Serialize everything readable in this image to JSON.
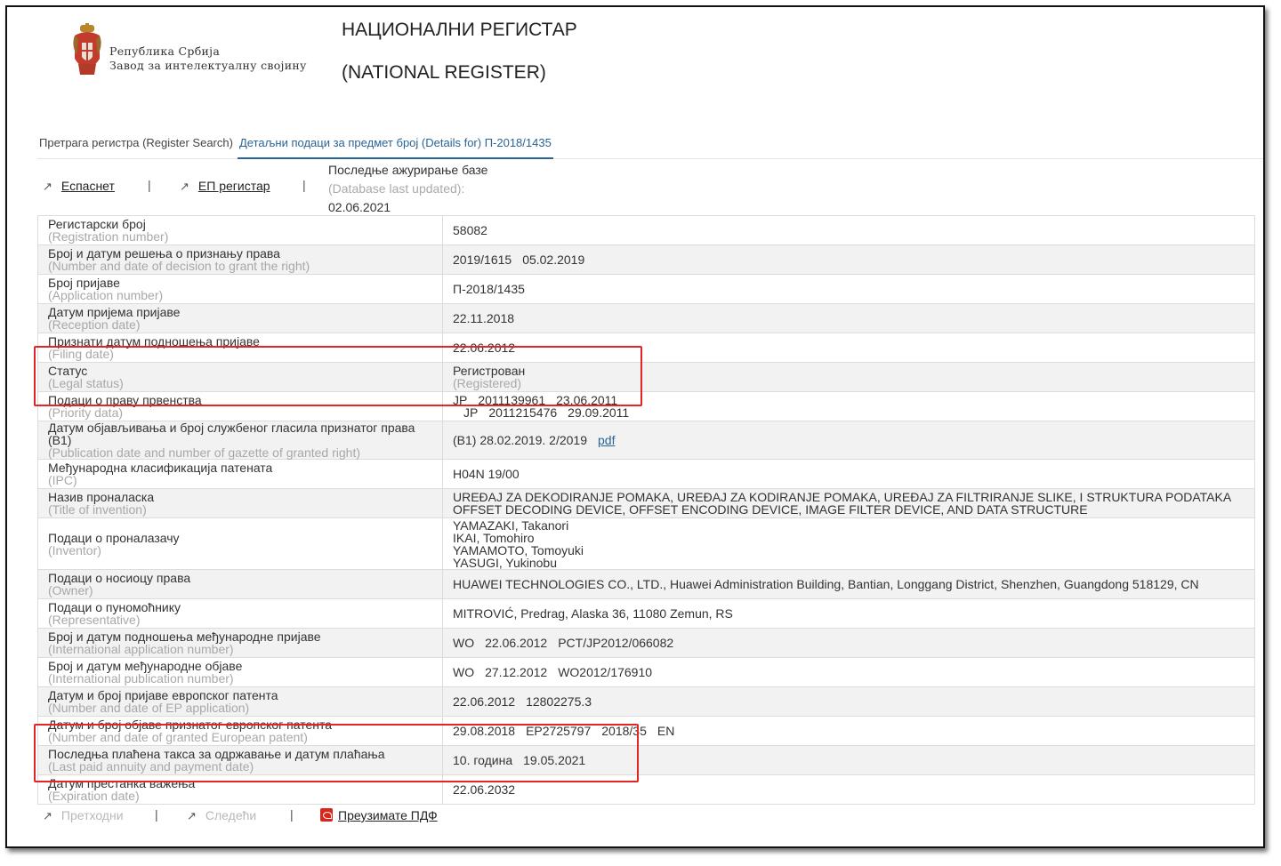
{
  "header": {
    "institution_line1": "Република Србија",
    "institution_line2": "Завод за интелектуалну својину",
    "title_sr": "НАЦИОНАЛНИ РЕГИСТАР",
    "title_en": "(NATIONAL REGISTER)"
  },
  "tabs": {
    "search": "Претрага регистра (Register Search)",
    "details": "Детаљни подаци за предмет број (Details for) П-2018/1435"
  },
  "links": {
    "espacenet": "Еспаснет",
    "ep_register": "ЕП регистар",
    "separator": "|"
  },
  "db_update": {
    "label_sr": "Последње ажурирање базе",
    "label_en": "(Database last updated):",
    "date": "02.06.2021"
  },
  "rows": [
    {
      "label_sr": "Регистарски број",
      "label_en": "(Registration number)",
      "value": "58082"
    },
    {
      "label_sr": "Број и датум решења о признању права",
      "label_en": "(Number and date of decision to grant the right)",
      "value_a": "2019/1615",
      "value_b": "05.02.2019"
    },
    {
      "label_sr": "Број пријаве",
      "label_en": "(Application number)",
      "value": "П-2018/1435"
    },
    {
      "label_sr": "Датум пријема пријаве",
      "label_en": "(Reception date)",
      "value": "22.11.2018"
    },
    {
      "label_sr": "Признати датум подношења пријаве",
      "label_en": "(Filing date)",
      "value": "22.06.2012"
    },
    {
      "label_sr": "Статус",
      "label_en": "(Legal status)",
      "value": "Регистрован",
      "value_en": "(Registered)"
    },
    {
      "label_sr": "Подаци о праву првенства",
      "label_en": "(Priority data)",
      "priority": [
        {
          "country": "JP",
          "number": "2011139961",
          "date": "23.06.2011"
        },
        {
          "country": "JP",
          "number": "2011215476",
          "date": "29.09.2011"
        }
      ]
    },
    {
      "label_sr": "Датум објављивања и број службеног гласила признатог права (B1)",
      "label_en": "(Publication date and number of gazette of granted right)",
      "value": "(B1) 28.02.2019. 2/2019",
      "link": "pdf"
    },
    {
      "label_sr": "Међународна класификација патената",
      "label_en": "(IPC)",
      "value": "H04N 19/00"
    },
    {
      "label_sr": "Назив проналаска",
      "label_en": "(Title of invention)",
      "value_line1": "UREĐAJ ZA DEKODIRANJE POMAKA, UREĐAJ ZA KODIRANJE POMAKA, UREĐAJ ZA FILTRIRANJE SLIKE, I STRUKTURA PODATAKA",
      "value_line2": "OFFSET DECODING DEVICE, OFFSET ENCODING DEVICE, IMAGE FILTER DEVICE, AND DATA STRUCTURE"
    },
    {
      "label_sr": "Подаци о проналазачу",
      "label_en": "(Inventor)",
      "inventors": [
        "YAMAZAKI, Takanori",
        "IKAI, Tomohiro",
        "YAMAMOTO, Tomoyuki",
        "YASUGI, Yukinobu"
      ]
    },
    {
      "label_sr": "Подаци о носиоцу права",
      "label_en": "(Owner)",
      "value": "HUAWEI TECHNOLOGIES CO., LTD., Huawei Administration Building, Bantian, Longgang District, Shenzhen, Guangdong 518129, CN"
    },
    {
      "label_sr": "Подаци о пуномоћнику",
      "label_en": "(Representative)",
      "value": "MITROVIĆ, Predrag, Alaska 36, 11080 Zemun, RS"
    },
    {
      "label_sr": "Број и датум подношења међународне пријаве",
      "label_en": "(International application number)",
      "value_a": "WO",
      "value_b": "22.06.2012",
      "value_c": "PCT/JP2012/066082"
    },
    {
      "label_sr": "Број и датум међународне објаве",
      "label_en": "(International publication number)",
      "value_a": "WO",
      "value_b": "27.12.2012",
      "value_c": "WO2012/176910"
    },
    {
      "label_sr": "Датум и број пријаве европског патента",
      "label_en": "(Number and date of EP application)",
      "value_a": "22.06.2012",
      "value_b": "12802275.3"
    },
    {
      "label_sr": "Датум и број објаве признатог европског патента",
      "label_en": "(Number and date of granted European patent)",
      "value_a": "29.08.2018",
      "value_b": "EP2725797",
      "value_c": "2018/35",
      "value_d": "EN"
    },
    {
      "label_sr": "Последња плаћена такса за одржавање и датум плаћања",
      "label_en": "(Last paid annuity and payment date)",
      "value_a": "10. година",
      "value_b": "19.05.2021"
    },
    {
      "label_sr": "Датум престанка важења",
      "label_en": "(Expiration date)",
      "value": "22.06.2032"
    }
  ],
  "footer": {
    "previous": "Претходни",
    "next": "Следећи",
    "download_pdf": "Преузимате ПДФ",
    "separator": "|"
  },
  "colors": {
    "link_blue": "#2a6496",
    "highlight_red": "#e32525",
    "row_alt": "#f2f2f2",
    "pdf_icon": "#d9261c"
  }
}
